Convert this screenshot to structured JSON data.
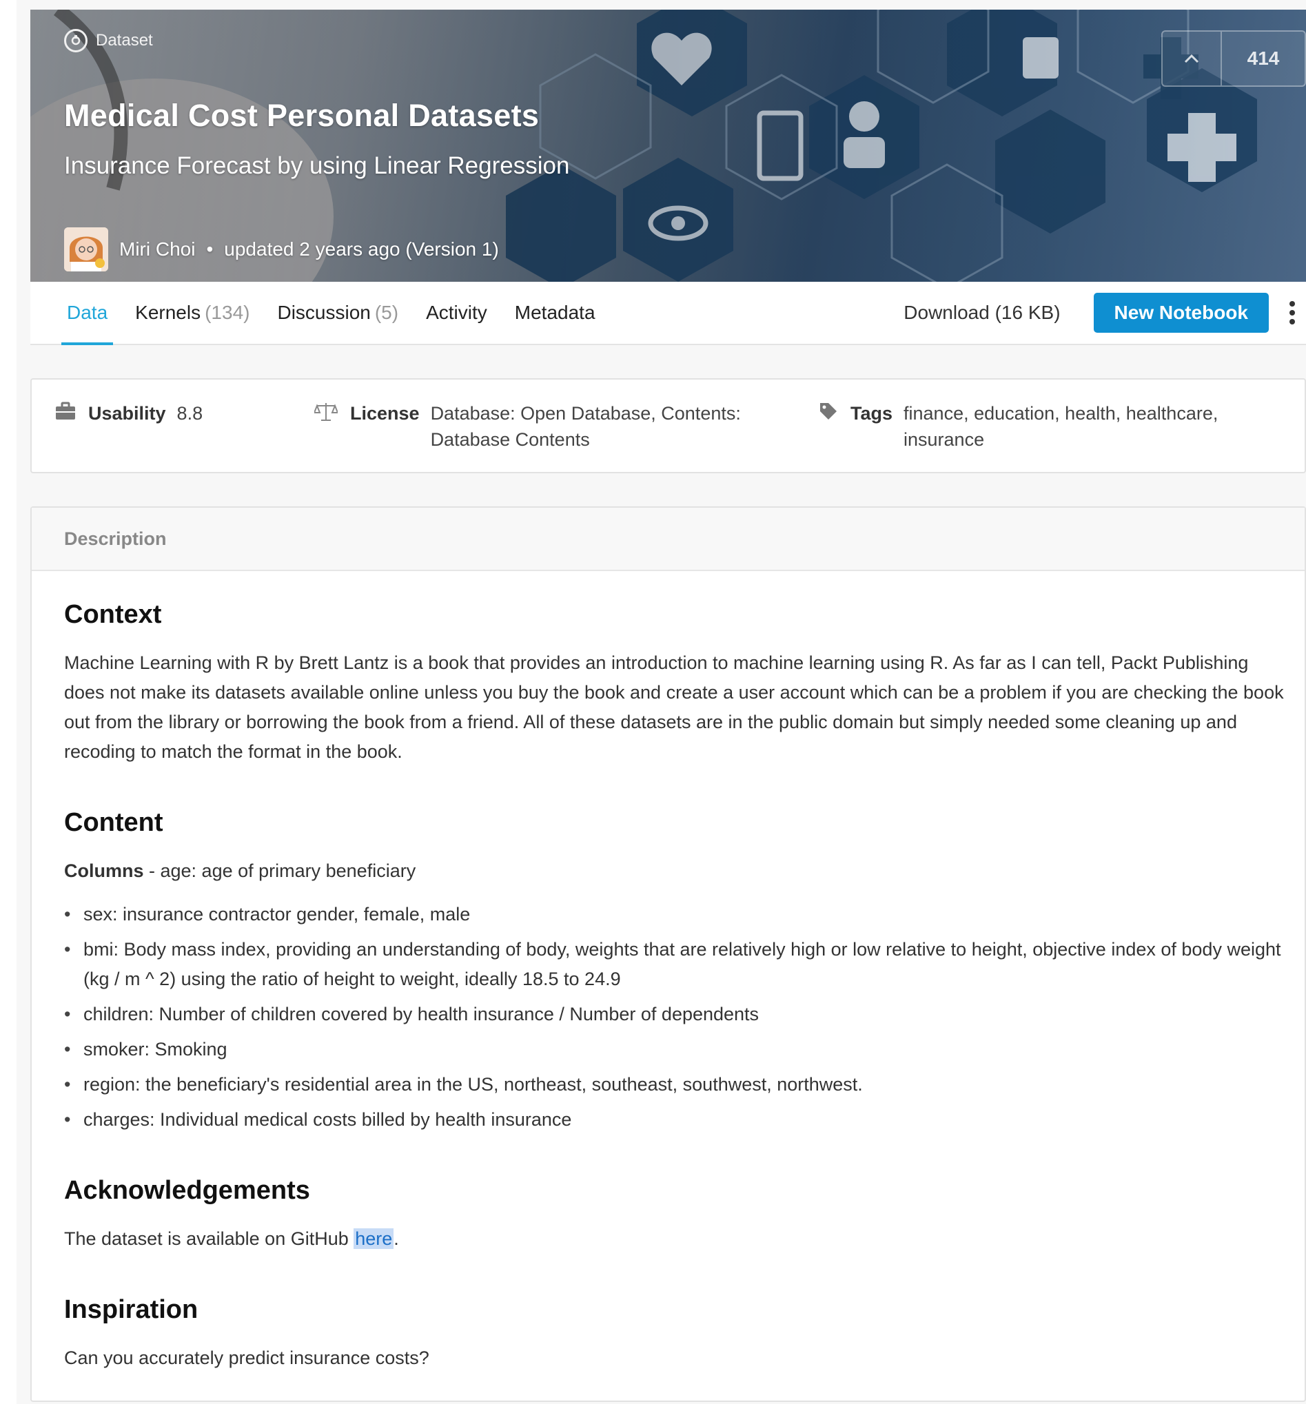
{
  "header": {
    "type_label": "Dataset",
    "title": "Medical Cost Personal Datasets",
    "subtitle": "Insurance Forecast by using Linear Regression",
    "author": "Miri Choi",
    "updated": "updated 2 years ago (Version 1)",
    "vote_count": "414"
  },
  "tabs": [
    {
      "label": "Data",
      "count": ""
    },
    {
      "label": "Kernels",
      "count": "(134)"
    },
    {
      "label": "Discussion",
      "count": "(5)"
    },
    {
      "label": "Activity",
      "count": ""
    },
    {
      "label": "Metadata",
      "count": ""
    }
  ],
  "actions": {
    "download_label": "Download (16 KB)",
    "new_notebook_label": "New Notebook"
  },
  "meta": {
    "usability_label": "Usability",
    "usability_value": "8.8",
    "license_label": "License",
    "license_line1": "Database: Open Database, Contents:",
    "license_line2": "Database Contents",
    "tags_label": "Tags",
    "tags_line1": "finance, education, health, healthcare,",
    "tags_line2": "insurance"
  },
  "description": {
    "header": "Description",
    "context_heading": "Context",
    "context_text": "Machine Learning with R by Brett Lantz is a book that provides an introduction to machine learning using R. As far as I can tell, Packt Publishing does not make its datasets available online unless you buy the book and create a user account which can be a problem if you are checking the book out from the library or borrowing the book from a friend. All of these datasets are in the public domain but simply needed some cleaning up and recoding to match the format in the book.",
    "content_heading": "Content",
    "columns_label": "Columns",
    "columns_intro": " - age: age of primary beneficiary",
    "columns": [
      "sex: insurance contractor gender, female, male",
      "bmi: Body mass index, providing an understanding of body, weights that are relatively high or low relative to height, objective index of body weight (kg / m ^ 2) using the ratio of height to weight, ideally 18.5 to 24.9",
      "children: Number of children covered by health insurance / Number of dependents",
      "smoker: Smoking",
      "region: the beneficiary's residential area in the US, northeast, southeast, southwest, northwest.",
      "charges: Individual medical costs billed by health insurance"
    ],
    "ack_heading": "Acknowledgements",
    "ack_text_before": "The dataset is available on GitHub ",
    "ack_link": "here",
    "ack_text_after": ".",
    "inspiration_heading": "Inspiration",
    "inspiration_text": "Can you accurately predict insurance costs?"
  },
  "colors": {
    "accent": "#20a6d9",
    "button": "#0f8fd1",
    "link": "#1c6fc7",
    "link_highlight": "#c7dbf6"
  },
  "icons": {
    "dataset": "dataset-icon",
    "upvote": "chevron-up-icon",
    "more": "more-vertical-icon",
    "usability": "briefcase-icon",
    "license": "scale-icon",
    "tags": "tag-icon"
  }
}
